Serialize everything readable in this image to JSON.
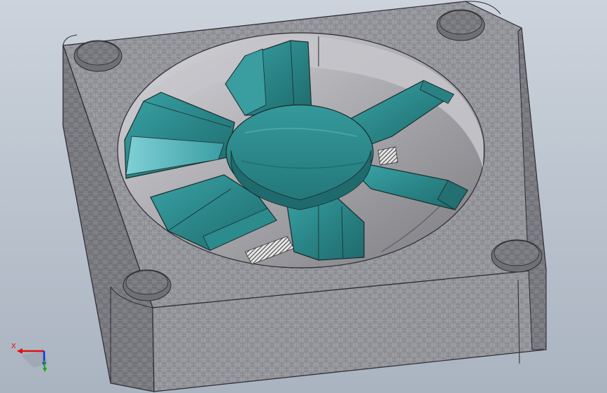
{
  "viewport": {
    "background_top": "#ccd3dc",
    "background_bottom": "#aab4c0"
  },
  "model": {
    "frame_color": "#8d8d94",
    "frame_dark": "#6e6e75",
    "blade_color": "#2f8f8f",
    "blade_highlight": "#5fb8bf",
    "blade_dark": "#1f6a6c",
    "blade_count": 6
  },
  "triad": {
    "x_label": "X",
    "x_axis_color": "#dd1111",
    "y_axis_color": "#11aa11",
    "z_axis_color": "#1133dd"
  }
}
